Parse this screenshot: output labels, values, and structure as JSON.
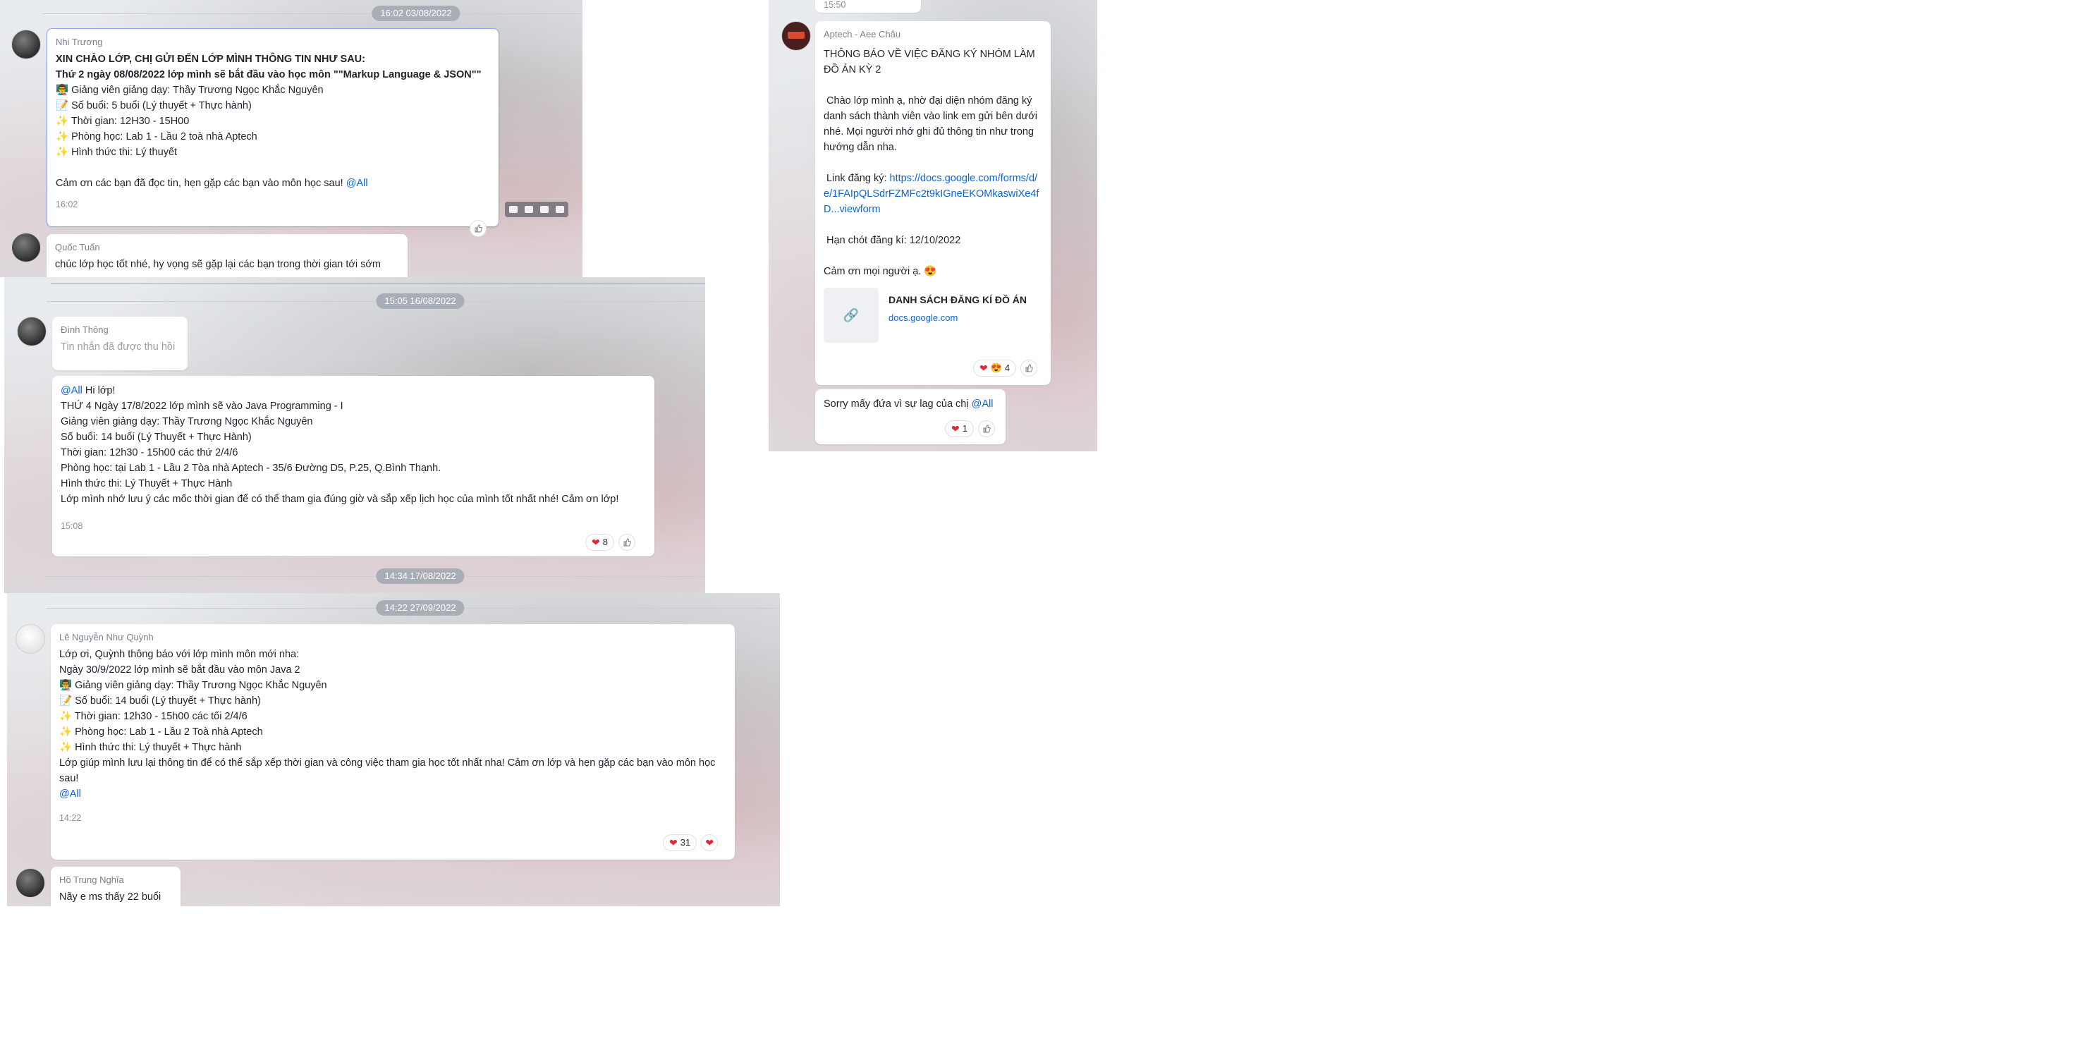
{
  "panel1": {
    "timestamp": "16:02 03/08/2022",
    "msg1": {
      "sender": "Nhi Trương",
      "lines": [
        "XIN CHÀO LỚP, CHỊ GỬI ĐẾN LỚP MÌNH THÔNG TIN NHƯ SAU:",
        "Thứ 2 ngày 08/08/2022 lớp mình sẽ bắt đầu vào học môn \"\"Markup Language & JSON\"\"",
        "👨‍🏫 Giảng viên giảng dạy: Thầy Trương Ngọc Khắc Nguyên",
        "📝 Số buổi: 5 buổi (Lý thuyết + Thực hành)",
        "✨ Thời gian: 12H30 - 15H00",
        "✨ Phòng học: Lab 1 - Lầu 2 toà nhà Aptech",
        "✨ Hình thức thi: Lý thuyết",
        "Cảm ơn các bạn đã đọc tin, hẹn gặp các bạn vào môn học sau!"
      ],
      "mention": "@All",
      "time": "16:02"
    },
    "msg2": {
      "sender": "Quốc Tuấn",
      "text": "chúc lớp học tốt nhé, hy vọng sẽ gặp lại các bạn trong thời gian tới sớm"
    }
  },
  "panel2": {
    "timestamp": "15:05 16/08/2022",
    "msg1": {
      "sender": "Đình Thông",
      "text": "Tin nhắn đã được thu hồi"
    },
    "msg2": {
      "mention": "@All",
      "first_line_rest": " Hi lớp!",
      "lines": [
        "THỨ 4 Ngày 17/8/2022 lớp mình sẽ vào Java Programming - I",
        "Giảng viên giảng dạy: Thầy Trương Ngọc Khắc Nguyên",
        "Số buổi: 14 buổi (Lý Thuyết + Thực Hành)",
        "Thời gian: 12h30 - 15h00 các thứ 2/4/6",
        "Phòng học: tại Lab 1 - Lầu 2 Tòa nhà Aptech - 35/6 Đường D5, P.25, Q.Bình Thạnh.",
        "Hình thức thi: Lý Thuyết + Thực Hành",
        "Lớp mình nhớ lưu ý các mốc thời gian để có thể tham gia đúng giờ và sắp xếp lịch học của mình tốt nhất nhé! Cảm ơn lớp!"
      ],
      "time": "15:08",
      "reaction_count": "8"
    },
    "timestamp_bottom": "14:34 17/08/2022"
  },
  "panel3": {
    "timestamp": "14:22 27/09/2022",
    "msg1": {
      "sender": "Lê Nguyễn Như Quỳnh",
      "lines": [
        "Lớp ơi, Quỳnh thông báo với lớp mình môn mới nha:",
        "Ngày 30/9/2022 lớp mình sẽ bắt đầu vào môn Java 2",
        "👨‍🏫 Giảng viên giảng dạy: Thầy Trương Ngọc Khắc Nguyên",
        "📝 Số buổi: 14 buổi (Lý thuyết + Thực hành)",
        "✨ Thời gian: 12h30 - 15h00 các tối 2/4/6",
        "✨ Phòng học: Lab 1 - Lầu 2 Toà nhà Aptech",
        "✨ Hình thức thi: Lý thuyết + Thực hành",
        "Lớp giúp mình lưu lại thông tin để có thể sắp xếp thời gian và công việc tham gia học tốt nhất nha! Cảm ơn lớp và hẹn gặp các bạn vào môn học sau!"
      ],
      "mention": "@All",
      "time": "14:22",
      "reaction_count": "31"
    },
    "msg2": {
      "sender": "Hồ Trung Nghĩa",
      "text": "Nãy e ms thấy 22 buổi"
    }
  },
  "panel4": {
    "top_time": "15:50",
    "msg1": {
      "sender": "Aptech - Aee Châu",
      "title_lines": [
        "THÔNG BÁO VỀ VIỆC ĐĂNG KÝ NHÓM LÀM",
        "ĐỒ ÁN KỲ 2"
      ],
      "body": " Chào lớp mình ạ, nhờ đại diện nhóm đăng ký danh sách thành viên vào link em gửi bên dưới nhé. Mọi người nhớ ghi đủ thông tin như trong hướng dẫn nha.",
      "link_label": " Link đăng ký: ",
      "link_url": "https://docs.google.com/forms/d/e/1FAIpQLSdrFZMFc2t9kIGneEKOMkaswiXe4fD...viewform",
      "deadline": " Hạn chót đăng kí: 12/10/2022",
      "thanks": "Cảm ơn mọi người ạ. 😍",
      "preview_title": "DANH SÁCH ĐĂNG KÍ ĐỒ ÁN",
      "preview_domain": "docs.google.com",
      "reaction_count": "4"
    },
    "msg2": {
      "text": "Sorry mấy đứa vì sự lag của chị ",
      "mention": "@All",
      "reaction_count": "1"
    }
  }
}
